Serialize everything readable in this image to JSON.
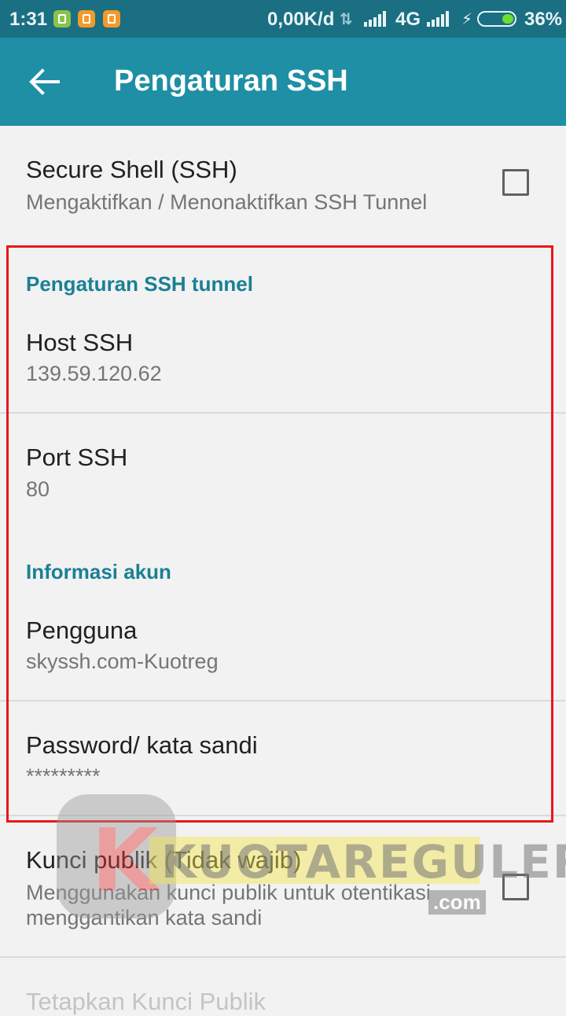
{
  "status_bar": {
    "time": "1:31",
    "net_speed": "0,00K/d",
    "network": "4G",
    "battery": "36%"
  },
  "app_bar": {
    "title": "Pengaturan SSH"
  },
  "settings": {
    "ssh_toggle": {
      "title": "Secure Shell (SSH)",
      "summary": "Mengaktifkan / Menonaktifkan SSH Tunnel",
      "checked": false
    },
    "category_tunnel": "Pengaturan SSH tunnel",
    "host": {
      "title": "Host SSH",
      "value": "139.59.120.62"
    },
    "port": {
      "title": "Port SSH",
      "value": "80"
    },
    "category_account": "Informasi akun",
    "user": {
      "title": "Pengguna",
      "value": "skyssh.com-Kuotreg"
    },
    "password": {
      "title": "Password/ kata sandi",
      "value": "*********"
    },
    "public_key": {
      "title": "Kunci publik (Tidak wajib)",
      "summary_line1": "Menggunakan kunci publik untuk otentikasi",
      "summary_line2": "menggantikan kata sandi",
      "checked": false
    },
    "set_public_key": {
      "title": "Tetapkan Kunci Publik"
    }
  },
  "watermark": {
    "word": "KUOTAREGULER",
    "suffix": ".com"
  },
  "colors": {
    "status_bar": "#1a6f82",
    "app_bar": "#1e8fa5",
    "category_text": "#1a8095",
    "highlight_box": "#e81818"
  }
}
